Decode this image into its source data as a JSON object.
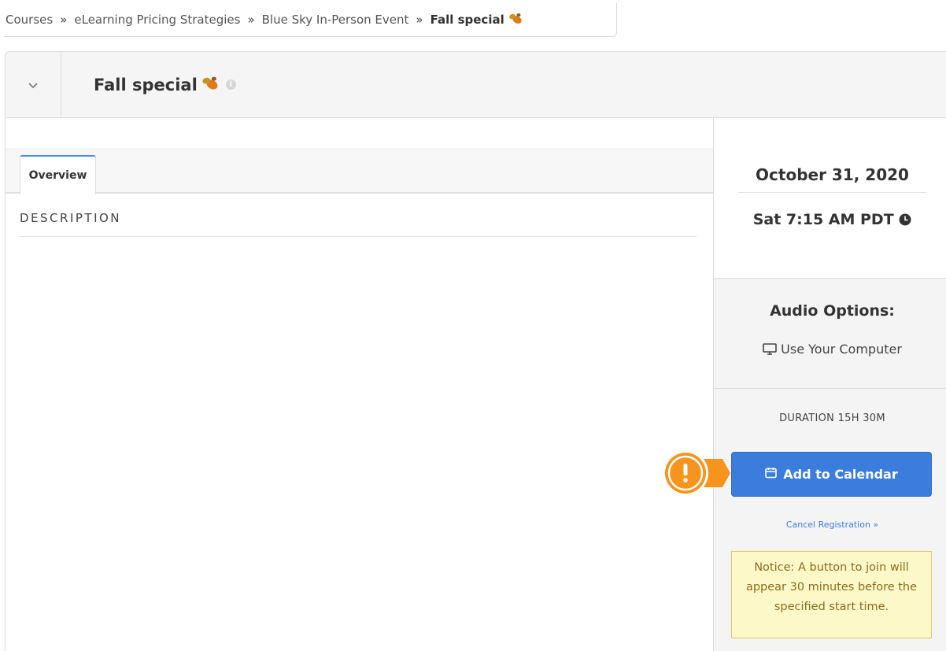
{
  "breadcrumb": {
    "items": [
      "Courses",
      "eLearning Pricing Strategies",
      "Blue Sky In-Person Event",
      "Fall special"
    ],
    "separator": "»"
  },
  "header": {
    "title": "Fall special",
    "info_icon": "info-icon",
    "toggle_icon": "chevron-down-icon"
  },
  "tabs": [
    {
      "label": "Overview",
      "active": true
    }
  ],
  "main": {
    "section_label": "DESCRIPTION"
  },
  "sidebar": {
    "date": "October 31, 2020",
    "time": "Sat 7:15 AM PDT",
    "audio": {
      "title": "Audio Options:",
      "option": "Use Your Computer"
    },
    "duration": "DURATION 15H 30M",
    "calendar_button": "Add to Calendar",
    "cancel_link": "Cancel Registration »",
    "notice": "Notice: A button to join will appear 30 minutes before the specified start time."
  },
  "colors": {
    "accent": "#3b7ddd",
    "callout": "#f7941d",
    "notice_bg": "#fcf8c8"
  }
}
